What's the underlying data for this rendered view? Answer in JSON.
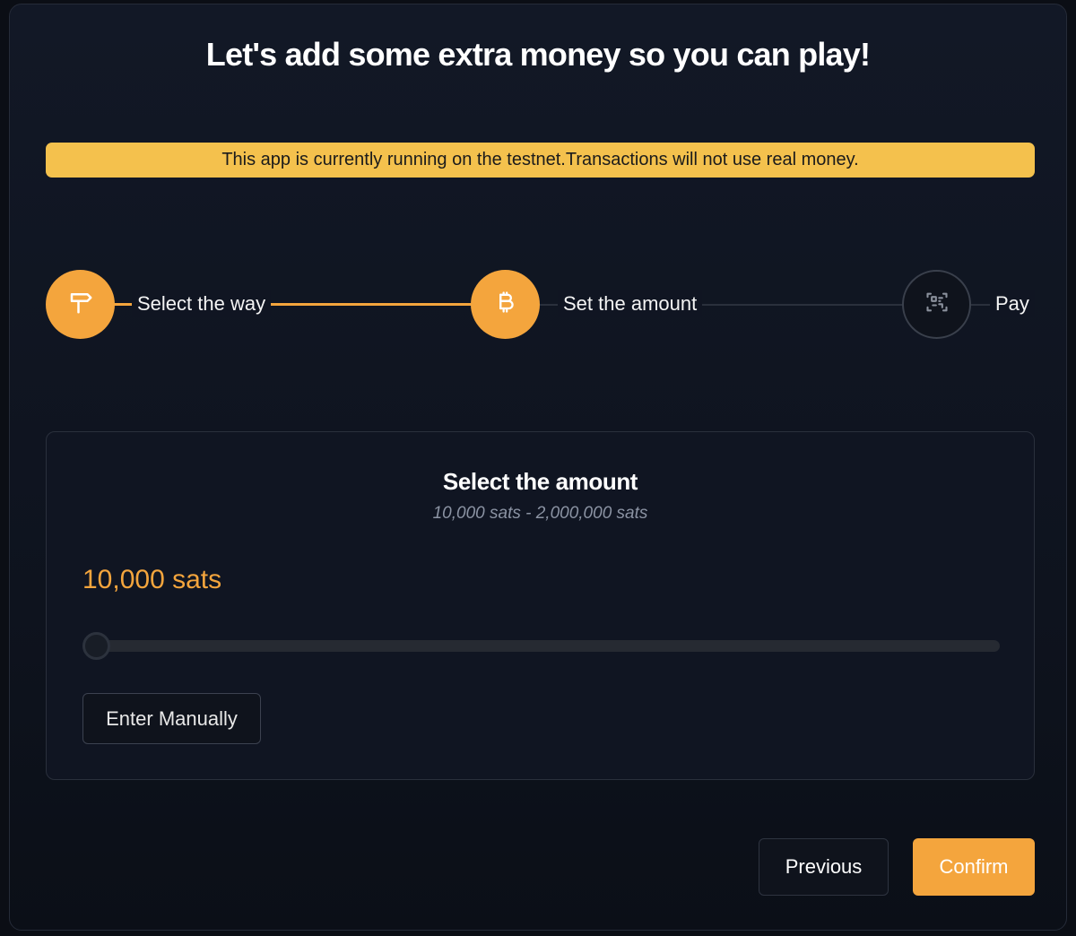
{
  "header": {
    "title": "Let's add some extra money so you can play!"
  },
  "banner": {
    "text": "This app is currently running on the testnet.Transactions will not use real money."
  },
  "stepper": {
    "steps": [
      {
        "label": "Select the way",
        "icon": "signpost-icon",
        "state": "completed"
      },
      {
        "label": "Set the amount",
        "icon": "bitcoin-icon",
        "state": "active"
      },
      {
        "label": "Pay",
        "icon": "qr-scan-icon",
        "state": "pending"
      }
    ]
  },
  "amount_panel": {
    "title": "Select the amount",
    "range_text": "10,000 sats - 2,000,000 sats",
    "current_amount": "10,000 sats",
    "slider": {
      "min": 10000,
      "max": 2000000,
      "value": 10000
    },
    "manual_button": "Enter Manually"
  },
  "footer": {
    "previous_label": "Previous",
    "confirm_label": "Confirm"
  },
  "colors": {
    "accent": "#f4a53d",
    "banner": "#f4c14d",
    "background": "#0b0e15"
  }
}
